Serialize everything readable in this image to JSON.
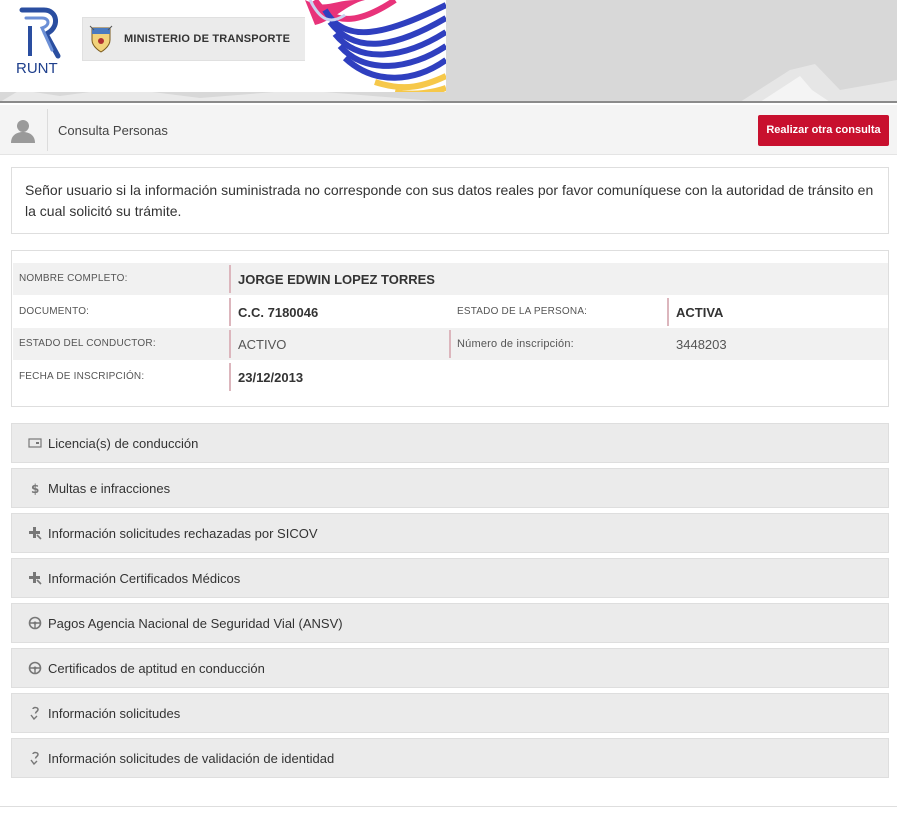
{
  "header": {
    "logo_text": "RUNT",
    "ministry_name": "MINISTERIO DE TRANSPORTE",
    "logo_color": "#1e3f8c"
  },
  "titlebar": {
    "title": "Consulta Personas",
    "button_label": "Realizar otra consulta",
    "button_color": "#c8102e"
  },
  "notice": {
    "text": "Señor usuario si la información suministrada no corresponde con sus datos reales por favor comuníquese con la autoridad de tránsito en la cual solicitó su trámite."
  },
  "person": {
    "nombre_label": "NOMBRE COMPLETO:",
    "nombre_value": "JORGE EDWIN LOPEZ TORRES",
    "documento_label": "DOCUMENTO:",
    "documento_value": "C.C. 7180046",
    "estado_persona_label": "ESTADO DE LA PERSONA:",
    "estado_persona_value": "ACTIVA",
    "estado_conductor_label": "ESTADO DEL CONDUCTOR:",
    "estado_conductor_value": "ACTIVO",
    "inscripcion_num_label": "Número de inscripción:",
    "inscripcion_num_value": "3448203",
    "fecha_label": "FECHA DE INSCRIPCIÓN:",
    "fecha_value": "23/12/2013"
  },
  "sections": [
    {
      "label": "Licencia(s) de conducción",
      "icon": "license-card-icon"
    },
    {
      "label": "Multas e infracciones",
      "icon": "dollar-icon"
    },
    {
      "label": "Información solicitudes rechazadas por SICOV",
      "icon": "medical-cross-icon"
    },
    {
      "label": "Información Certificados Médicos",
      "icon": "medical-cross-icon"
    },
    {
      "label": "Pagos Agencia Nacional de Seguridad Vial (ANSV)",
      "icon": "steering-wheel-icon"
    },
    {
      "label": "Certificados de aptitud en conducción",
      "icon": "steering-wheel-icon"
    },
    {
      "label": "Información solicitudes",
      "icon": "question-arrow-icon"
    },
    {
      "label": "Información solicitudes de validación de identidad",
      "icon": "question-arrow-icon"
    }
  ]
}
